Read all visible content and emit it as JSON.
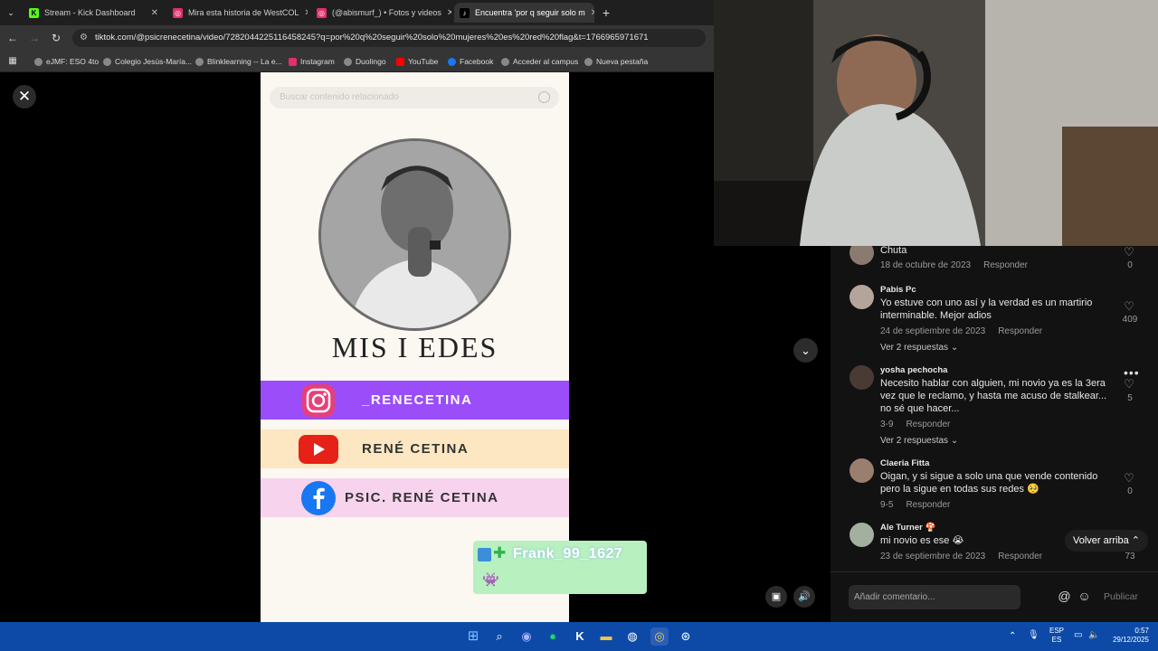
{
  "browser": {
    "tabs": [
      {
        "label": "Stream - Kick Dashboard",
        "icon": "kick-icon",
        "color": "#53fc18"
      },
      {
        "label": "Mira esta historia de WestCOL",
        "icon": "instagram-icon",
        "color": "#e1306c"
      },
      {
        "label": "(@abismurf_) • Fotos y videos",
        "icon": "instagram-icon",
        "color": "#e1306c"
      },
      {
        "label": "Encuentra 'por q seguir solo m",
        "icon": "tiktok-icon",
        "color": "#ffffff"
      }
    ],
    "url": "tiktok.com/@psicrenecetina/video/7282044225116458245?q=por%20q%20seguir%20solo%20mujeres%20es%20red%20flag&t=1766965971671",
    "bookmarks": [
      "eJMF: ESO 4to",
      "Colegio Jesús-María...",
      "Blinklearning -- La e...",
      "Instagram",
      "Duolingo",
      "YouTube",
      "Facebook",
      "Acceder al campus",
      "Nueva pestaña"
    ]
  },
  "video": {
    "search_placeholder": "Buscar contenido relacionado",
    "heading": "MIS I EDES",
    "socials": [
      {
        "label": "_RENECETINA",
        "icon": "instagram-icon",
        "bg": "#9b4dfa",
        "fg": "#ffffff"
      },
      {
        "label": "RENÉ CETINA",
        "icon": "youtube-icon",
        "bg": "#fde7c2",
        "fg": "#333333"
      },
      {
        "label": "PSIC. RENÉ CETINA",
        "icon": "facebook-icon",
        "bg": "#f7d3ee",
        "fg": "#333333"
      }
    ]
  },
  "overlay": {
    "chat_user": "Frank_99_1627"
  },
  "comments": [
    {
      "user": "",
      "text": "Chuta",
      "date": "18 de octubre de 2023",
      "reply": "Responder",
      "likes": "0"
    },
    {
      "user": "Pabis Pc",
      "text": "Yo estuve con uno así y la verdad es un martirio interminable. Mejor adios",
      "date": "24 de septiembre de 2023",
      "reply": "Responder",
      "likes": "409",
      "replies": "Ver 2 respuestas"
    },
    {
      "user": "yosha pechocha",
      "text": "Necesito hablar con alguien, mi novio ya es la 3era vez que le reclamo, y hasta me acuso de stalkear... no sé que hacer...",
      "date": "3-9",
      "reply": "Responder",
      "likes": "5",
      "replies": "Ver 2 respuestas"
    },
    {
      "user": "Claeria Fitta",
      "text": "Oigan, y si sigue a solo una que vende contenido pero la sigue en todas sus redes 🥺",
      "date": "9-5",
      "reply": "Responder",
      "likes": "0"
    },
    {
      "user": "Ale Turner 🍄",
      "text": "mi novio es ese 😭",
      "date": "23 de septiembre de 2023",
      "reply": "Responder",
      "likes": "73"
    }
  ],
  "back_to_top": "Volver arriba",
  "composer": {
    "placeholder": "Añadir comentario...",
    "publish": "Publicar"
  },
  "taskbar": {
    "lang_top": "ESP",
    "lang_bottom": "ES",
    "time": "0:57",
    "date": "29/12/2025"
  }
}
